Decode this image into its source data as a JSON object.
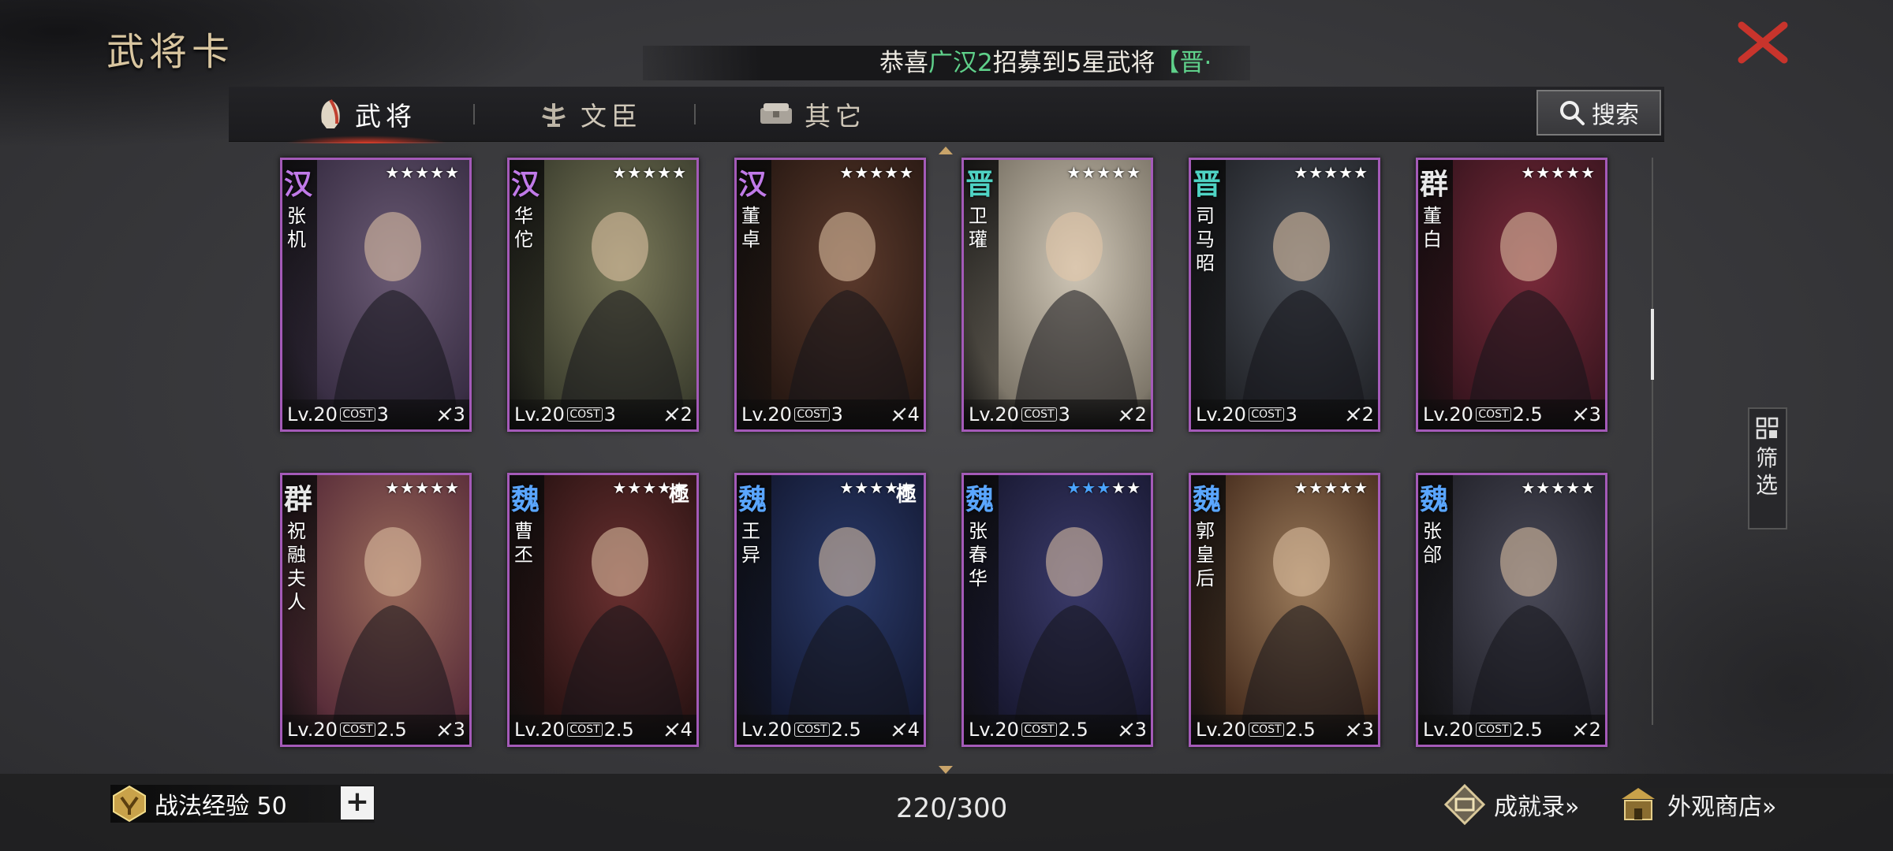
{
  "header": {
    "title": "武将卡",
    "close_icon": "close-icon"
  },
  "notice": {
    "prefix": "恭喜",
    "player": "广汉2",
    "middle": "招募到5星武将",
    "suffix": "【晋·"
  },
  "tabs": [
    {
      "label": "武将",
      "icon": "helmet-icon",
      "active": true
    },
    {
      "label": "文臣",
      "icon": "scroll-icon",
      "active": false
    },
    {
      "label": "其它",
      "icon": "chest-icon",
      "active": false
    }
  ],
  "search": {
    "label": "搜索"
  },
  "cards": [
    {
      "faction": "汉",
      "name": "张机",
      "stars": 5,
      "lit_stars": 0,
      "level": "Lv.20",
      "cost": "3",
      "troop": "3",
      "ji": false,
      "faction_color": "#c07ae8"
    },
    {
      "faction": "汉",
      "name": "华佗",
      "stars": 5,
      "lit_stars": 0,
      "level": "Lv.20",
      "cost": "3",
      "troop": "2",
      "ji": false,
      "faction_color": "#c07ae8"
    },
    {
      "faction": "汉",
      "name": "董卓",
      "stars": 5,
      "lit_stars": 0,
      "level": "Lv.20",
      "cost": "3",
      "troop": "4",
      "ji": false,
      "faction_color": "#c07ae8"
    },
    {
      "faction": "晋",
      "name": "卫瓘",
      "stars": 5,
      "lit_stars": 0,
      "level": "Lv.20",
      "cost": "3",
      "troop": "2",
      "ji": false,
      "faction_color": "#4fd3c4"
    },
    {
      "faction": "晋",
      "name": "司马昭",
      "stars": 5,
      "lit_stars": 0,
      "level": "Lv.20",
      "cost": "3",
      "troop": "2",
      "ji": false,
      "faction_color": "#4fd3c4"
    },
    {
      "faction": "群",
      "name": "董白",
      "stars": 5,
      "lit_stars": 0,
      "level": "Lv.20",
      "cost": "2.5",
      "troop": "3",
      "ji": false,
      "faction_color": "#e8e8e8"
    },
    {
      "faction": "群",
      "name": "祝融夫人",
      "stars": 5,
      "lit_stars": 0,
      "level": "Lv.20",
      "cost": "2.5",
      "troop": "3",
      "ji": false,
      "faction_color": "#e8e8e8"
    },
    {
      "faction": "魏",
      "name": "曹丕",
      "stars": 5,
      "lit_stars": 0,
      "level": "Lv.20",
      "cost": "2.5",
      "troop": "4",
      "ji": true,
      "faction_color": "#5aa6ff"
    },
    {
      "faction": "魏",
      "name": "王异",
      "stars": 5,
      "lit_stars": 0,
      "level": "Lv.20",
      "cost": "2.5",
      "troop": "4",
      "ji": true,
      "faction_color": "#5aa6ff"
    },
    {
      "faction": "魏",
      "name": "张春华",
      "stars": 5,
      "lit_stars": 3,
      "level": "Lv.20",
      "cost": "2.5",
      "troop": "3",
      "ji": false,
      "faction_color": "#5aa6ff"
    },
    {
      "faction": "魏",
      "name": "郭皇后",
      "stars": 5,
      "lit_stars": 0,
      "level": "Lv.20",
      "cost": "2.5",
      "troop": "3",
      "ji": false,
      "faction_color": "#5aa6ff"
    },
    {
      "faction": "魏",
      "name": "张郃",
      "stars": 5,
      "lit_stars": 0,
      "level": "Lv.20",
      "cost": "2.5",
      "troop": "2",
      "ji": false,
      "faction_color": "#5aa6ff"
    }
  ],
  "ji_label": "極",
  "cost_tag": "COST",
  "filter": {
    "label": "筛选"
  },
  "footer": {
    "exp_label": "战法经验 50",
    "add_label": "+",
    "count": "220/300",
    "achievement": "成就录»",
    "shop": "外观商店»"
  }
}
